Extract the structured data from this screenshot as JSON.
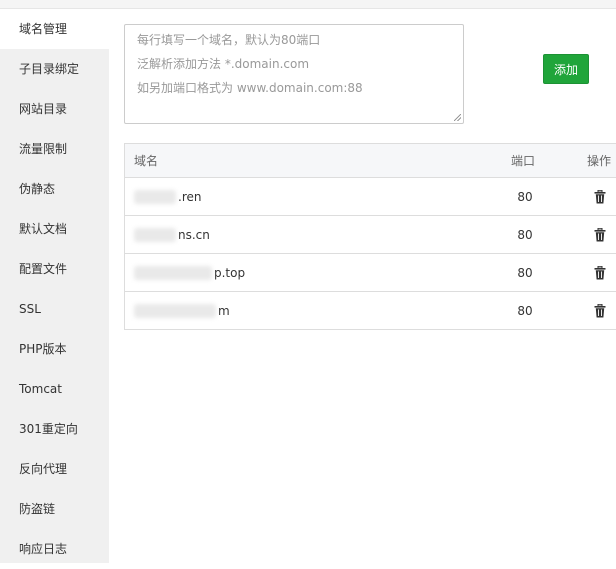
{
  "sidebar": {
    "items": [
      {
        "label": "域名管理",
        "active": true
      },
      {
        "label": "子目录绑定"
      },
      {
        "label": "网站目录"
      },
      {
        "label": "流量限制"
      },
      {
        "label": "伪静态"
      },
      {
        "label": "默认文档"
      },
      {
        "label": "配置文件"
      },
      {
        "label": "SSL"
      },
      {
        "label": "PHP版本"
      },
      {
        "label": "Tomcat"
      },
      {
        "label": "301重定向"
      },
      {
        "label": "反向代理"
      },
      {
        "label": "防盗链"
      },
      {
        "label": "响应日志"
      }
    ]
  },
  "domain_input": {
    "placeholder_lines": [
      "每行填写一个域名，默认为80端口",
      "泛解析添加方法 *.domain.com",
      "如另加端口格式为 www.domain.com:88"
    ],
    "value": ""
  },
  "add_button": {
    "label": "添加"
  },
  "accent_color": "#20a53a",
  "table": {
    "headers": {
      "domain": "域名",
      "port": "端口",
      "action": "操作"
    },
    "rows": [
      {
        "domain_visible": ".ren",
        "port": "80"
      },
      {
        "domain_visible": "ns.cn",
        "port": "80"
      },
      {
        "domain_visible": "p.top",
        "port": "80"
      },
      {
        "domain_visible": "m",
        "port": "80"
      }
    ],
    "row_action_icon": "trash-icon"
  }
}
